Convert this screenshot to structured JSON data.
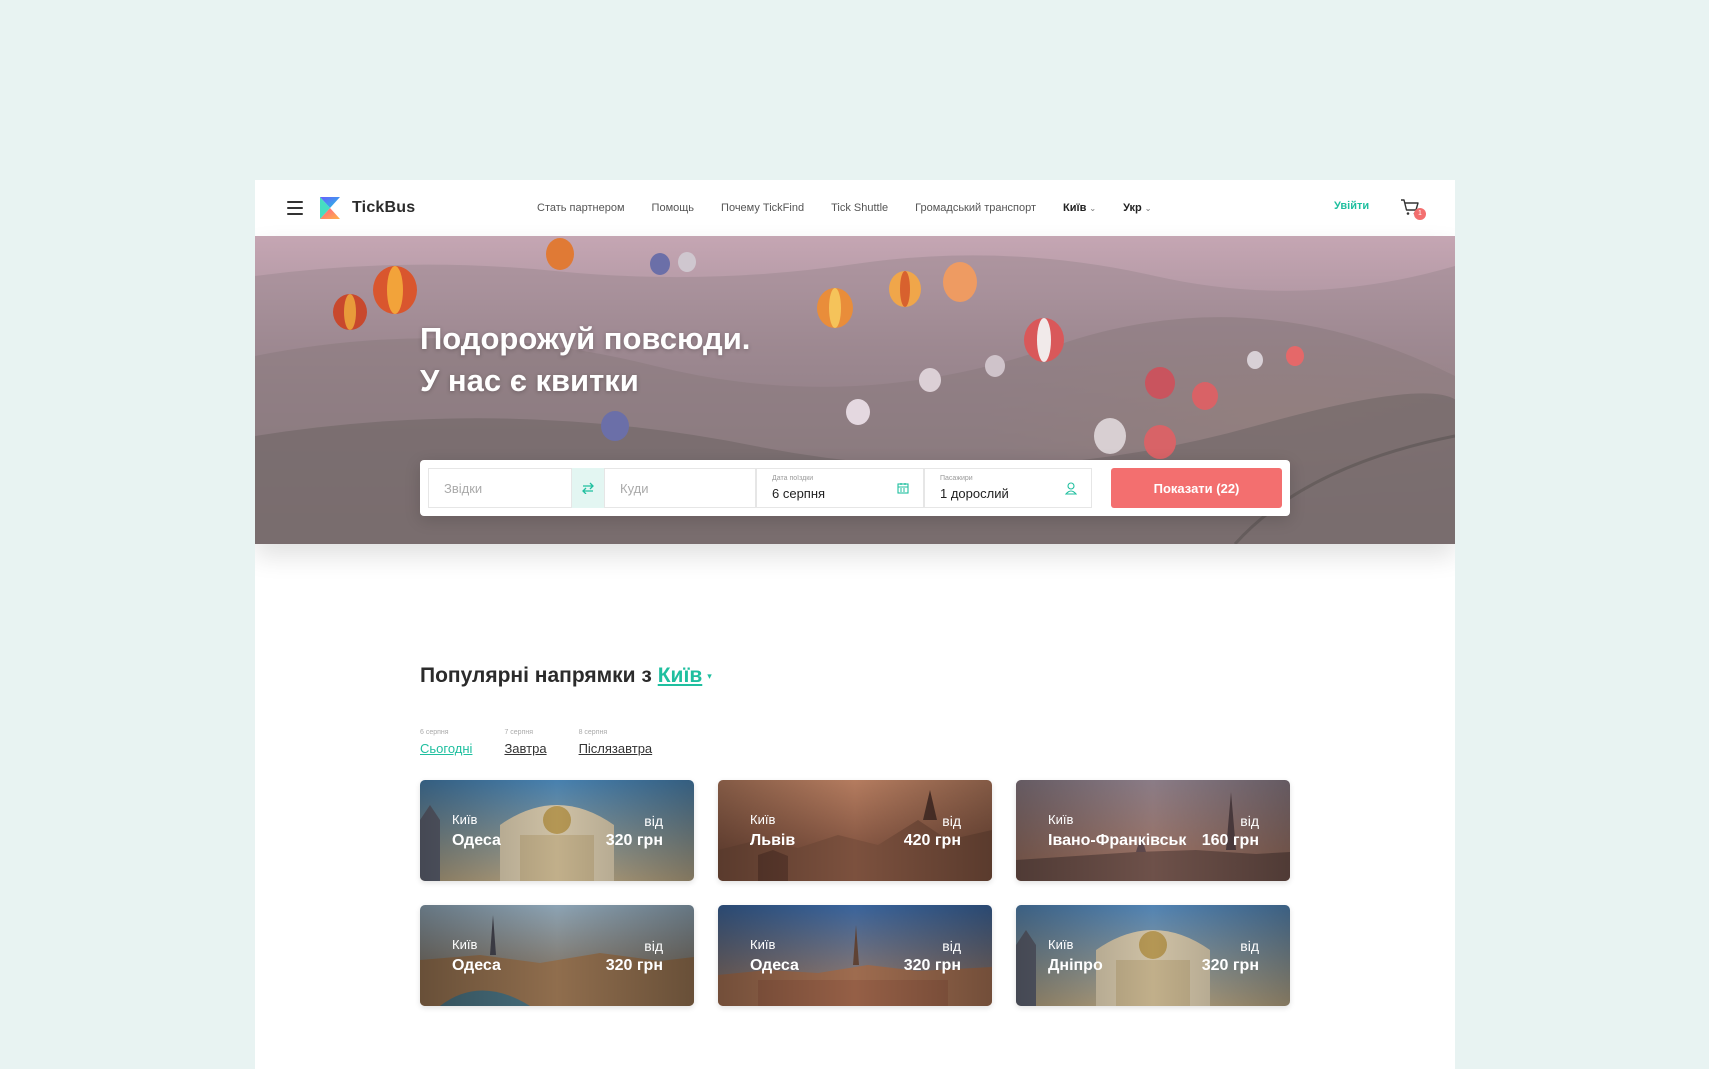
{
  "header": {
    "brand": "TickBus",
    "nav": [
      "Стать партнером",
      "Помощь",
      "Почему TickFind",
      "Tick Shuttle",
      "Громадський транспорт"
    ],
    "city_select": "Київ",
    "lang_select": "Укр",
    "login": "Увійти",
    "cart_count": "1"
  },
  "hero": {
    "title_line1": "Подорожуй повсюди.",
    "title_line2": "У нас є квитки"
  },
  "search": {
    "from_placeholder": "Звідки",
    "to_placeholder": "Куди",
    "date_label": "Дата поїздки",
    "date_value": "6 серпня",
    "passengers_label": "Пасажири",
    "passengers_value": "1 дорослий",
    "submit": "Показати (22)"
  },
  "popular": {
    "title": "Популярні напрямки з",
    "city": "Київ",
    "tabs": [
      {
        "date": "6 серпня",
        "label": "Сьогодні",
        "active": true
      },
      {
        "date": "7 серпня",
        "label": "Завтра",
        "active": false
      },
      {
        "date": "8 серпня",
        "label": "Післязавтра",
        "active": false
      }
    ],
    "cards": [
      {
        "from": "Київ",
        "to": "Одеса",
        "vid": "від",
        "price": "320 грн"
      },
      {
        "from": "Київ",
        "to": "Львів",
        "vid": "від",
        "price": "420 грн"
      },
      {
        "from": "Київ",
        "to": "Івано-Франківськ",
        "vid": "від",
        "price": "160 грн"
      },
      {
        "from": "Київ",
        "to": "Одеса",
        "vid": "від",
        "price": "320 грн"
      },
      {
        "from": "Київ",
        "to": "Одеса",
        "vid": "від",
        "price": "320 грн"
      },
      {
        "from": "Київ",
        "to": "Дніпро",
        "vid": "від",
        "price": "320 грн"
      }
    ]
  },
  "colors": {
    "accent": "#1fbf9f",
    "cta": "#f36f6f",
    "background": "#e8f3f2"
  }
}
